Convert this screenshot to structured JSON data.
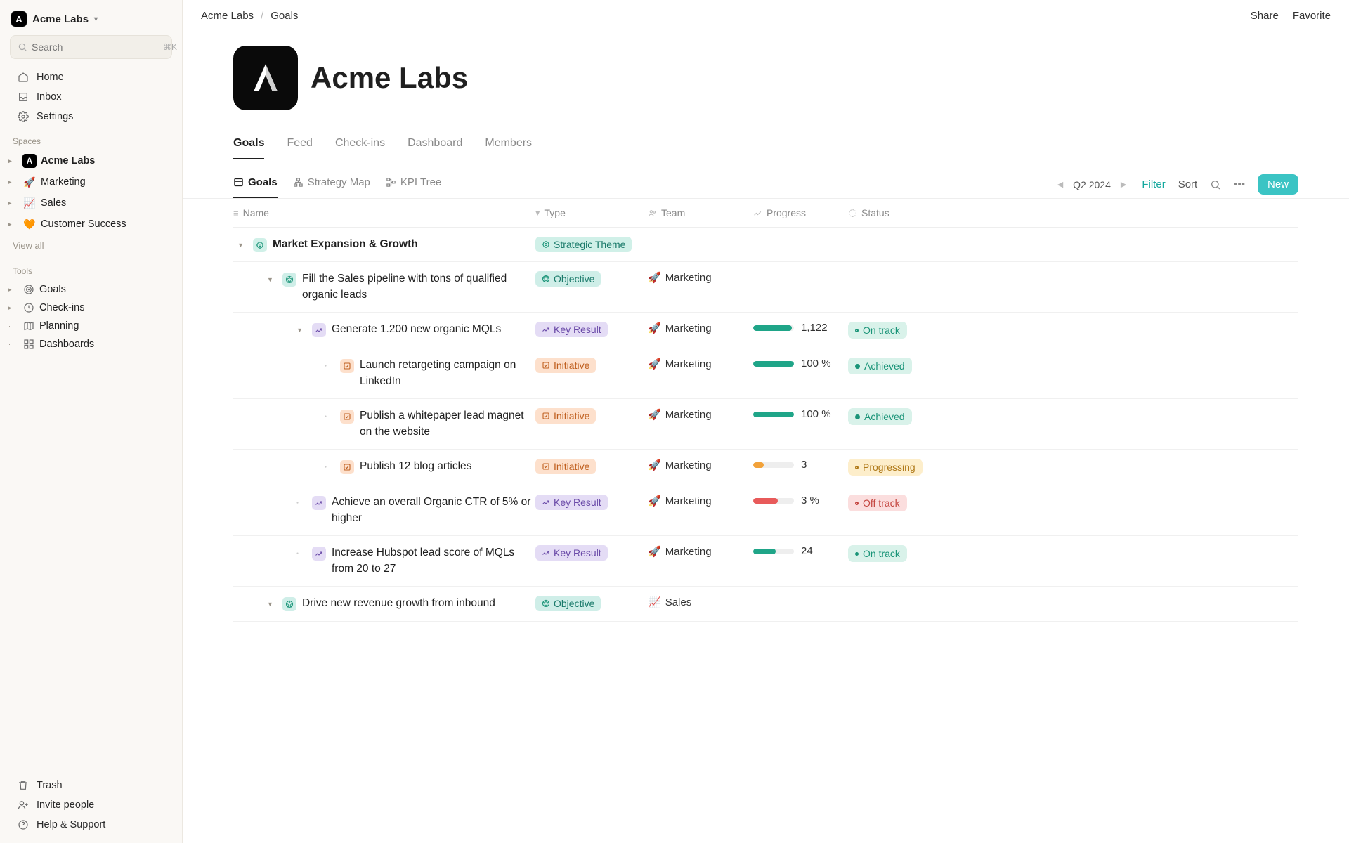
{
  "workspace": {
    "name": "Acme Labs",
    "logo_letter": "A"
  },
  "search": {
    "placeholder": "Search",
    "shortcut": "⌘K"
  },
  "nav": {
    "home": "Home",
    "inbox": "Inbox",
    "settings": "Settings"
  },
  "sections": {
    "spaces_label": "Spaces",
    "tools_label": "Tools",
    "view_all": "View all"
  },
  "spaces": [
    {
      "emoji_dark": true,
      "letter": "A",
      "label": "Acme Labs",
      "bold": true
    },
    {
      "emoji": "🚀",
      "label": "Marketing"
    },
    {
      "emoji": "📈",
      "label": "Sales"
    },
    {
      "emoji": "🧡",
      "label": "Customer Success"
    }
  ],
  "tools": [
    {
      "icon": "target",
      "label": "Goals",
      "expandable": true
    },
    {
      "icon": "clock",
      "label": "Check-ins",
      "expandable": true
    },
    {
      "icon": "map",
      "label": "Planning",
      "expandable": false
    },
    {
      "icon": "grid",
      "label": "Dashboards",
      "expandable": false
    }
  ],
  "sidebar_bottom": {
    "trash": "Trash",
    "invite": "Invite people",
    "help": "Help & Support"
  },
  "breadcrumb": {
    "root": "Acme Labs",
    "current": "Goals"
  },
  "topbar": {
    "share": "Share",
    "favorite": "Favorite"
  },
  "page": {
    "title": "Acme Labs"
  },
  "tabs": [
    "Goals",
    "Feed",
    "Check-ins",
    "Dashboard",
    "Members"
  ],
  "active_tab": "Goals",
  "subtabs": [
    {
      "icon": "list",
      "label": "Goals",
      "active": true
    },
    {
      "icon": "sitemap",
      "label": "Strategy Map"
    },
    {
      "icon": "tree",
      "label": "KPI Tree"
    }
  ],
  "period": "Q2 2024",
  "toolbar": {
    "filter": "Filter",
    "sort": "Sort",
    "new": "New"
  },
  "columns": {
    "name": "Name",
    "type": "Type",
    "team": "Team",
    "progress": "Progress",
    "status": "Status"
  },
  "type_labels": {
    "theme": "Strategic Theme",
    "objective": "Objective",
    "key_result": "Key Result",
    "initiative": "Initiative"
  },
  "teams": {
    "marketing": {
      "emoji": "🚀",
      "name": "Marketing"
    },
    "sales": {
      "emoji": "📈",
      "name": "Sales"
    }
  },
  "status_labels": {
    "ontrack": "On track",
    "achieved": "Achieved",
    "progressing": "Progressing",
    "offtrack": "Off track"
  },
  "rows": [
    {
      "indent": 0,
      "caret": "down",
      "type": "theme",
      "title": "Market Expansion & Growth"
    },
    {
      "indent": 1,
      "caret": "down",
      "type": "objective",
      "title": "Fill the Sales pipeline with tons of qualified organic leads",
      "team": "marketing"
    },
    {
      "indent": 2,
      "caret": "down",
      "type": "key_result",
      "title": "Generate 1.200 new organic MQLs",
      "team": "marketing",
      "progress_pct": 94,
      "progress_text": "1,122",
      "bar_color": "#1fa588",
      "status": "ontrack"
    },
    {
      "indent": 3,
      "caret": "dot",
      "type": "initiative",
      "title": "Launch retargeting campaign on LinkedIn",
      "team": "marketing",
      "progress_pct": 100,
      "progress_text": "100 %",
      "bar_color": "#1fa588",
      "status": "achieved"
    },
    {
      "indent": 3,
      "caret": "dot",
      "type": "initiative",
      "title": "Publish a whitepaper lead magnet on the website",
      "team": "marketing",
      "progress_pct": 100,
      "progress_text": "100 %",
      "bar_color": "#1fa588",
      "status": "achieved"
    },
    {
      "indent": 3,
      "caret": "dot",
      "type": "initiative",
      "title": "Publish 12 blog articles",
      "team": "marketing",
      "progress_pct": 25,
      "progress_text": "3",
      "bar_color": "#f2a23a",
      "status": "progressing"
    },
    {
      "indent": 2,
      "caret": "dot",
      "type": "key_result",
      "title": "Achieve an overall Organic CTR of 5% or higher",
      "team": "marketing",
      "progress_pct": 60,
      "progress_text": "3 %",
      "bar_color": "#e85a5a",
      "status": "offtrack"
    },
    {
      "indent": 2,
      "caret": "dot",
      "type": "key_result",
      "title": "Increase Hubspot lead score of MQLs from 20 to 27",
      "team": "marketing",
      "progress_pct": 55,
      "progress_text": "24",
      "bar_color": "#1fa588",
      "status": "ontrack"
    },
    {
      "indent": 1,
      "caret": "down",
      "type": "objective",
      "title": "Drive new revenue growth from inbound",
      "team": "sales"
    }
  ]
}
